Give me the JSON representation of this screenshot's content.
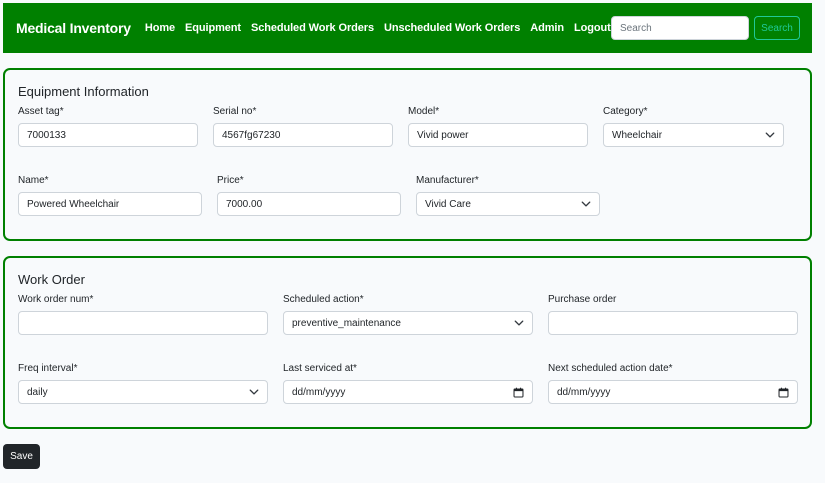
{
  "navbar": {
    "brand": "Medical Inventory",
    "links": [
      "Home",
      "Equipment",
      "Scheduled Work Orders",
      "Unscheduled Work Orders",
      "Admin",
      "Logout"
    ],
    "search_placeholder": "Search",
    "search_button": "Search"
  },
  "equipment": {
    "title": "Equipment Information",
    "asset_tag": {
      "label": "Asset tag*",
      "value": "7000133"
    },
    "serial_no": {
      "label": "Serial no*",
      "value": "4567fg67230"
    },
    "model": {
      "label": "Model*",
      "value": "Vivid power"
    },
    "category": {
      "label": "Category*",
      "value": "Wheelchair"
    },
    "name": {
      "label": "Name*",
      "value": "Powered Wheelchair"
    },
    "price": {
      "label": "Price*",
      "value": "7000.00"
    },
    "manufacturer": {
      "label": "Manufacturer*",
      "value": "Vivid Care"
    }
  },
  "work_order": {
    "title": "Work Order",
    "work_order_num": {
      "label": "Work order num*",
      "value": ""
    },
    "scheduled_action": {
      "label": "Scheduled action*",
      "value": "preventive_maintenance"
    },
    "purchase_order": {
      "label": "Purchase order",
      "value": ""
    },
    "freq_interval": {
      "label": "Freq interval*",
      "value": "daily"
    },
    "last_serviced_at": {
      "label": "Last serviced at*",
      "value": "dd/mm/yyyy"
    },
    "next_scheduled": {
      "label": "Next scheduled action date*",
      "value": "dd/mm/yyyy"
    }
  },
  "save_button": "Save",
  "colors": {
    "primary_green": "#008000",
    "search_teal": "#20c997",
    "dark_button": "#212529"
  },
  "icons": {
    "select": "chevron-down-icon",
    "date": "calendar-icon"
  }
}
